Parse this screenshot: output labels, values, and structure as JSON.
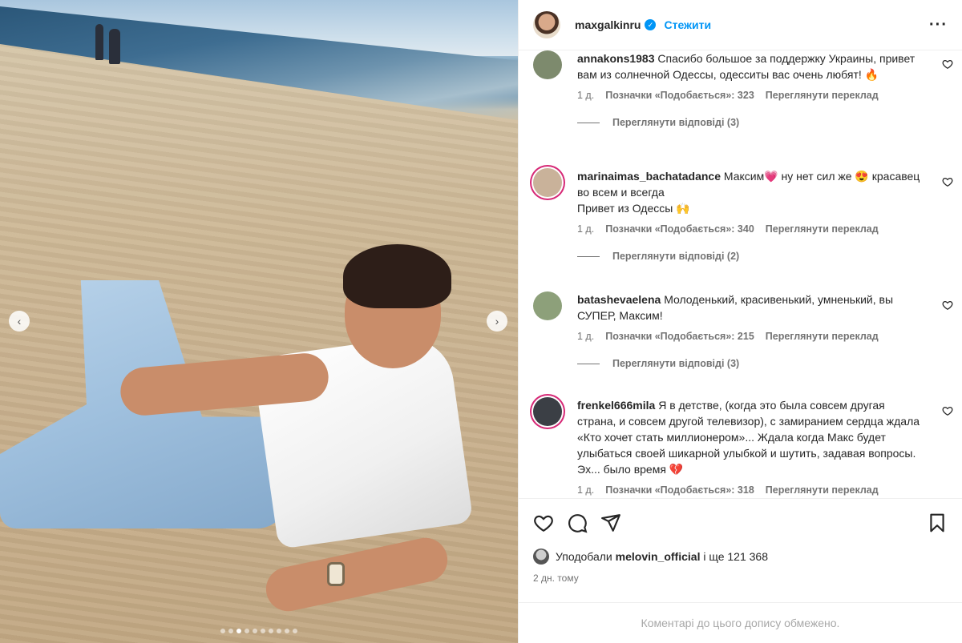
{
  "post": {
    "author": "maxgalkinru",
    "follow_label": "Стежити",
    "more_icon": "more-horizontal-icon"
  },
  "photo": {
    "nav_prev": "‹",
    "nav_next": "›",
    "slide_count": 10,
    "active_slide": 3
  },
  "comments": [
    {
      "user": "annakons1983",
      "text": "Спасибо большое за поддержку Украины, привет вам из солнечной Одессы, одесситы вас очень любят! 🔥",
      "time": "1 д.",
      "likes": "Позначки «Подобається»: 323",
      "translate": "Переглянути переклад",
      "replies": "Переглянути відповіді (3)",
      "avatar_color": "#7d8a6d"
    },
    {
      "user": "marinaimas_bachatadance",
      "text": "Максим💗 ну нет сил же 😍 красавец во всем и всегда\nПривет из Одессы 🙌",
      "time": "1 д.",
      "likes": "Позначки «Подобається»: 340",
      "translate": "Переглянути переклад",
      "replies": "Переглянути відповіді (2)",
      "avatar_color": "#c9b29a"
    },
    {
      "user": "batashevaelena",
      "text": "Молоденький, красивенький, умненький, вы СУПЕР, Максим!",
      "time": "1 д.",
      "likes": "Позначки «Подобається»: 215",
      "translate": "Переглянути переклад",
      "replies": "Переглянути відповіді (3)",
      "avatar_color": "#8da07a"
    },
    {
      "user": "frenkel666mila",
      "text": "Я в детстве, (когда это была совсем другая страна, и совсем другой телевизор), с замиранием сердца ждала «Кто хочет стать миллионером»... Ждала когда Макс будет улыбаться своей шикарной улыбкой и шутить, задавая вопросы. Эх... было время 💔",
      "time": "1 д.",
      "likes": "Позначки «Подобається»: 318",
      "translate": "Переглянути переклад",
      "avatar_color": "#3b3f45"
    }
  ],
  "actions": {
    "like_icon": "heart-icon",
    "comment_icon": "comment-icon",
    "share_icon": "share-icon",
    "save_icon": "bookmark-icon"
  },
  "likes_summary": {
    "prefix": "Уподобали",
    "user": "melovin_official",
    "suffix": "і ще 121 368"
  },
  "posted_time": "2 дн. тому",
  "comments_closed": "Коментарі до цього допису обмежено.",
  "colors": {
    "accent": "#0095f6",
    "muted": "#737373",
    "text": "#262626"
  }
}
